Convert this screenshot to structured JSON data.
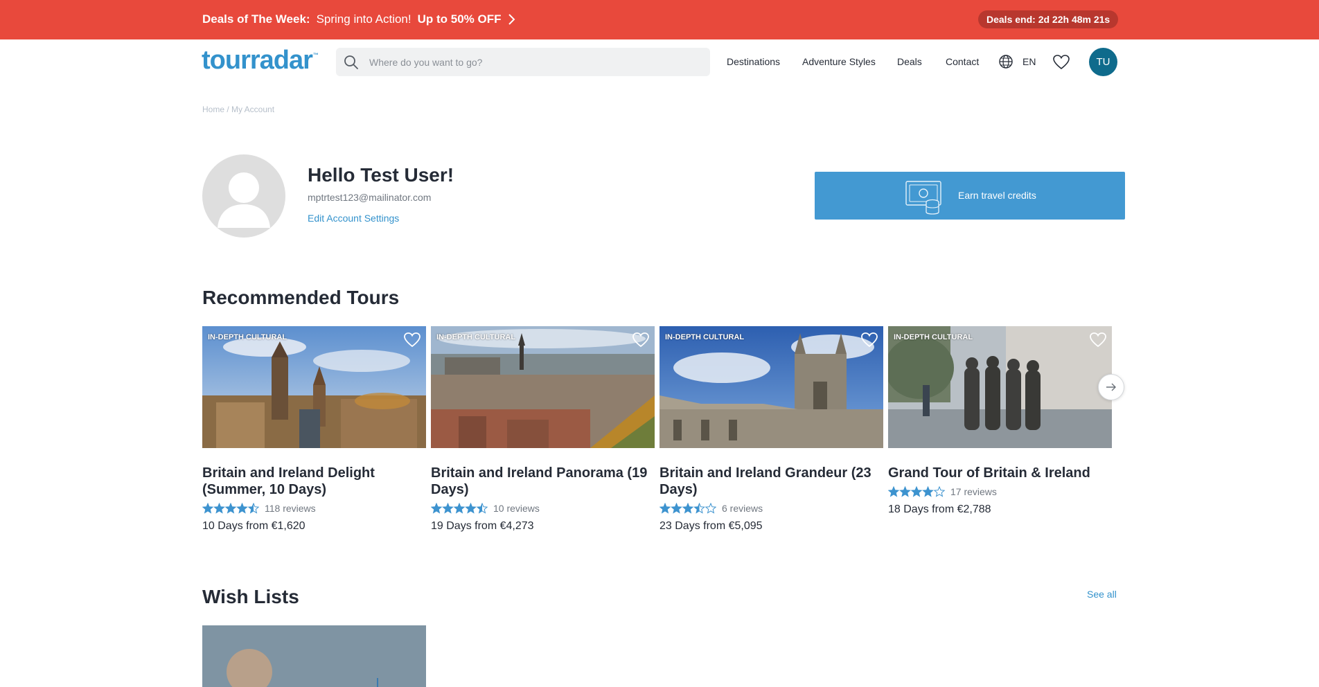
{
  "promo": {
    "label": "Deals of The Week:",
    "message": "Spring into Action!",
    "offer": "Up to 50% OFF",
    "deadline_label": "Deals end:",
    "countdown": "2d 22h 48m 21s",
    "background": "#e8493c"
  },
  "header": {
    "logo": "tourradar",
    "logo_mark": "™",
    "search_placeholder": "Where do you want to go?",
    "nav": [
      "Destinations",
      "Adventure Styles",
      "Deals",
      "Contact"
    ],
    "language": "EN",
    "user_initials": "TU",
    "icons": {
      "search": "search-icon",
      "globe": "globe-icon",
      "wishlist": "heart-icon"
    }
  },
  "breadcrumb": "Home / My Account",
  "profile": {
    "greeting": "Hello Test User!",
    "email": "mptrtest123@mailinator.com",
    "edit_link": "Edit Account Settings",
    "credits_button": "Earn travel credits"
  },
  "recommended": {
    "title": "Recommended Tours",
    "tours": [
      {
        "tag": "IN-DEPTH CULTURAL",
        "title": "Britain and Ireland Delight (Summer, 10 Days)",
        "rating": 4.5,
        "reviews": "118 reviews",
        "price": "10 Days from €1,620"
      },
      {
        "tag": "IN-DEPTH CULTURAL",
        "title": "Britain and Ireland Panorama (19 Days)",
        "rating": 4.5,
        "reviews": "10 reviews",
        "price": "19 Days from €4,273"
      },
      {
        "tag": "IN-DEPTH CULTURAL",
        "title": "Britain and Ireland Grandeur (23 Days)",
        "rating": 3.5,
        "reviews": "6 reviews",
        "price": "23 Days from €5,095"
      },
      {
        "tag": "IN-DEPTH CULTURAL",
        "title": "Grand Tour of Britain & Ireland",
        "rating": 4,
        "reviews": "17 reviews",
        "price": "18 Days from €2,788"
      }
    ]
  },
  "wishlists": {
    "title": "Wish Lists",
    "see_all": "See all"
  },
  "colors": {
    "accent": "#3392cc",
    "star": "#3d93cf",
    "avatar": "#0f6b8c",
    "credits": "#4399d2"
  }
}
